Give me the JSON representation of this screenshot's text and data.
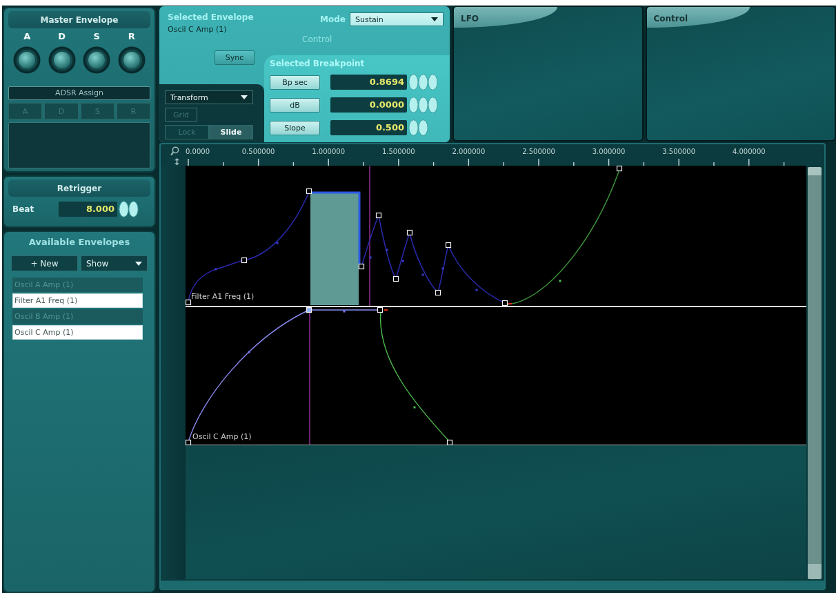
{
  "master_envelope": {
    "title": "Master Envelope",
    "knobs": [
      {
        "label": "A"
      },
      {
        "label": "D"
      },
      {
        "label": "S"
      },
      {
        "label": "R"
      }
    ],
    "assign": {
      "title": "ADSR Assign",
      "buttons": [
        {
          "label": "A",
          "disabled": true
        },
        {
          "label": "D",
          "disabled": true
        },
        {
          "label": "S",
          "disabled": true
        },
        {
          "label": "R",
          "disabled": true
        }
      ]
    }
  },
  "retrigger": {
    "title": "Retrigger",
    "label": "Beat",
    "value": "8.000",
    "kind": "coarse"
  },
  "available_envelopes": {
    "title": "Available Envelopes",
    "new_button": "+ New",
    "show_menu": "Show",
    "items": [
      {
        "label": "Oscil A Amp (1)",
        "selected": false
      },
      {
        "label": "Filter A1 Freq (1)",
        "selected": true
      },
      {
        "label": "Oscil B Amp (1)",
        "selected": false
      },
      {
        "label": "Oscil C Amp (1)",
        "selected": true
      }
    ]
  },
  "selected_envelope": {
    "title": "Selected Envelope",
    "name": "Oscil C Amp (1)",
    "mode_label": "Mode",
    "mode": "Sustain",
    "control_label": "Control",
    "sync_button": "Sync"
  },
  "transform": {
    "menu": "Transform",
    "grid_button": {
      "label": "Grid",
      "disabled": true
    },
    "modes": [
      {
        "label": "Lock",
        "selected": false
      },
      {
        "label": "Slide",
        "selected": true
      }
    ]
  },
  "selected_breakpoint": {
    "title": "Selected Breakpoint",
    "fields": [
      {
        "label": "Bp sec",
        "value": "0.8694",
        "kind": "fine"
      },
      {
        "label": "dB",
        "value": "0.0000",
        "kind": "fine"
      },
      {
        "label": "Slope",
        "value": "0.500",
        "kind": "coarse"
      }
    ]
  },
  "panels": [
    {
      "title": "LFO"
    },
    {
      "title": "Control"
    }
  ],
  "editor": {
    "ruler": [
      "0.0000",
      "0.500000",
      "1.000000",
      "1.500000",
      "2.000000",
      "2.500000",
      "3.000000",
      "3.500000",
      "4.000000"
    ],
    "lanes": [
      {
        "label": "Filter A1 Freq (1)"
      },
      {
        "label": "Oscil C Amp (1)"
      }
    ]
  }
}
